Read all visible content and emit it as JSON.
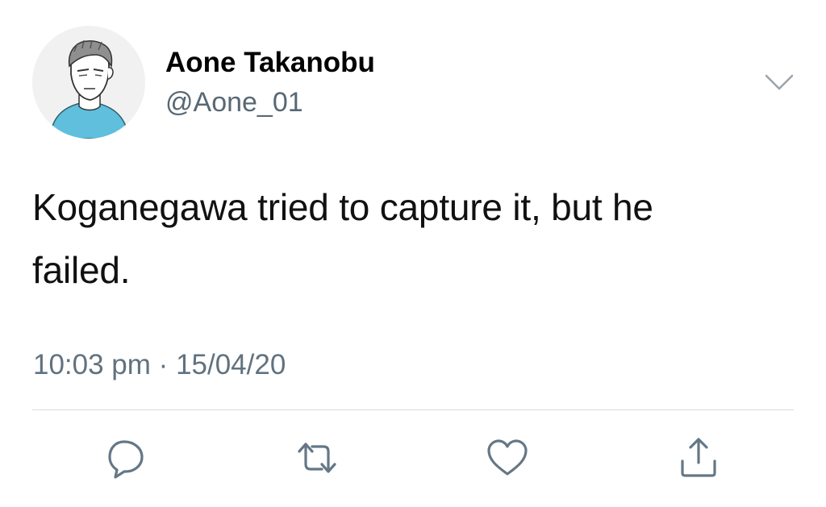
{
  "author": {
    "display_name": "Aone Takanobu",
    "handle": "@Aone_01",
    "avatar_icon": "profile-avatar"
  },
  "tweet": {
    "text": "Koganegawa tried to capture it, but he failed.",
    "time": "10:03 pm",
    "separator": "·",
    "date": "15/04/20"
  },
  "menu": {
    "icon": "chevron-down-icon"
  },
  "actions": [
    {
      "name": "reply",
      "icon": "comment-icon"
    },
    {
      "name": "retweet",
      "icon": "retweet-icon"
    },
    {
      "name": "like",
      "icon": "heart-icon"
    },
    {
      "name": "share",
      "icon": "share-icon"
    }
  ],
  "colors": {
    "icon": "#657786",
    "secondary_text": "#61727f",
    "divider": "#d6dbe0",
    "avatar_shirt": "#5fbfdc"
  }
}
